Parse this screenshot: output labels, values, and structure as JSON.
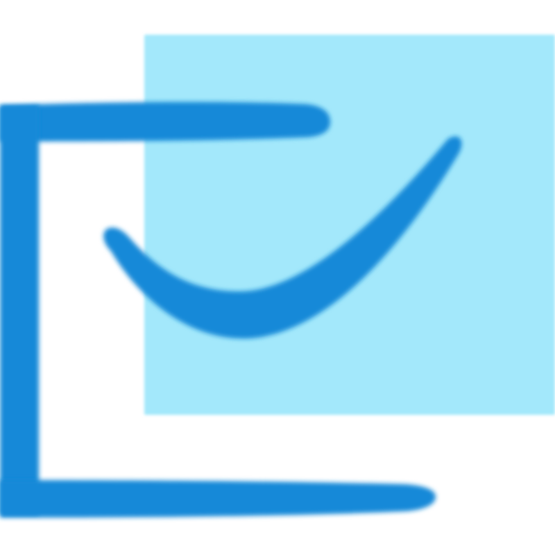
{
  "icon": {
    "name": "check-document-icon",
    "colors": {
      "background": "#ffffff",
      "panel": "#a3e8fb",
      "stroke": "#1689d8"
    }
  }
}
